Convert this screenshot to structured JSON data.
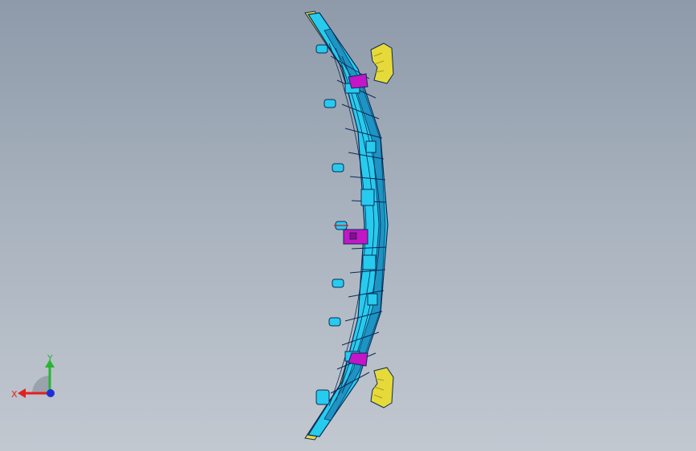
{
  "viewport": {
    "background_top": "#8e9aaa",
    "background_bottom": "#c2c8d0"
  },
  "model": {
    "colors": {
      "body": "#27cbee",
      "body_dark": "#1d8fbf",
      "edge": "#0b2a55",
      "bracket": "#e6d93a",
      "bracket_dark": "#a79b15",
      "clip": "#c316c6",
      "origin_marker": "#e01010"
    },
    "icons": [
      "bracket-icon",
      "clip-icon"
    ]
  },
  "triad": {
    "x_label": "X",
    "y_label": "Y",
    "x_color": "#e22020",
    "y_color": "#27b534",
    "z_color": "#1e2fd6"
  }
}
